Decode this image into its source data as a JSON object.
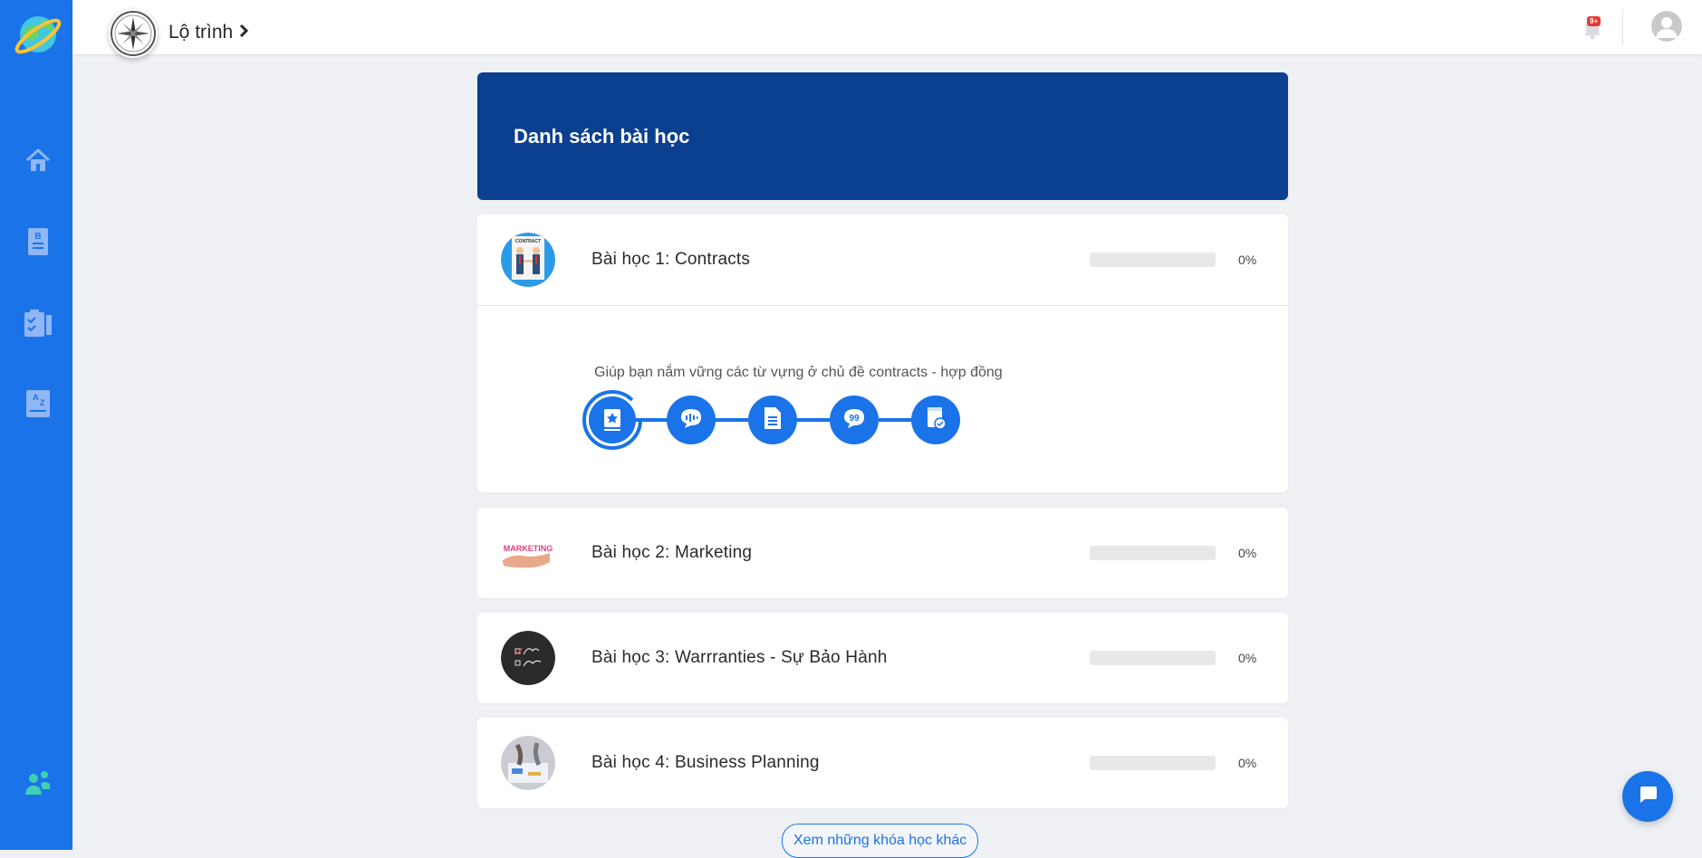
{
  "header": {
    "breadcrumb": "Lộ trình",
    "notification_badge": "9+"
  },
  "sidebar": {
    "items": [
      {
        "name": "home",
        "icon": "home-icon"
      },
      {
        "name": "vocabulary",
        "icon": "book-b-icon"
      },
      {
        "name": "exercises",
        "icon": "checklist-icon"
      },
      {
        "name": "dictionary",
        "icon": "az-book-icon"
      },
      {
        "name": "community",
        "icon": "people-icon"
      }
    ]
  },
  "main": {
    "title": "Danh sách bài học",
    "lessons": [
      {
        "title": "Bài học 1: Contracts",
        "progress": 0,
        "progress_label": "0%",
        "expanded": true,
        "description": "Giúp bạn nắm vững các từ vựng ở chủ đề contracts - hợp đồng",
        "steps": [
          "bookmark-star-icon",
          "speech-audio-icon",
          "document-icon",
          "quote-bubble-icon",
          "book-check-icon"
        ]
      },
      {
        "title": "Bài học 2: Marketing",
        "progress": 0,
        "progress_label": "0%"
      },
      {
        "title": "Bài học 3: Warrranties - Sự Bảo Hành",
        "progress": 0,
        "progress_label": "0%"
      },
      {
        "title": "Bài học 4: Business Planning",
        "progress": 0,
        "progress_label": "0%"
      }
    ],
    "more_label": "Xem những khóa học khác"
  },
  "colors": {
    "primary": "#1a73e8",
    "banner": "#0b3f8f",
    "background": "#eef0f4"
  }
}
